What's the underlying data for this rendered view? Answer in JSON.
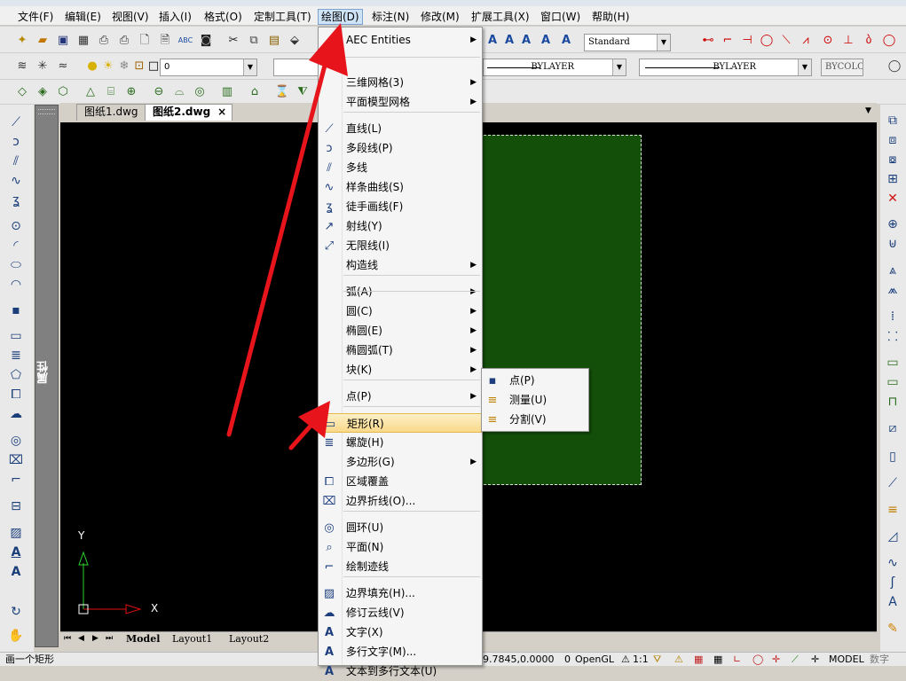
{
  "menubar": {
    "items": [
      "文件(F)",
      "编辑(E)",
      "视图(V)",
      "插入(I)",
      "格式(O)",
      "定制工具(T)",
      "绘图(D)",
      "标注(N)",
      "修改(M)",
      "扩展工具(X)",
      "窗口(W)",
      "帮助(H)"
    ],
    "active_index": 6
  },
  "toolbar1": {
    "text_style": "Standard"
  },
  "toolbar2": {
    "layer_value": "0",
    "linetype1": "BYLAYER",
    "linetype2": "BYLAYER",
    "color": "BYCOLOR"
  },
  "doc_tabs": {
    "tab1": "图纸1.dwg",
    "tab2": "图纸2.dwg",
    "close_glyph": "×"
  },
  "properties_panel": {
    "label": "属性"
  },
  "layout_tabs": [
    "Model",
    "Layout1",
    "Layout2"
  ],
  "ucs": {
    "x": "X",
    "y": "Y"
  },
  "draw_menu": {
    "items": [
      {
        "label": "AEC Entities",
        "icon": "",
        "submenu": true
      },
      {
        "label": "三维网格(3)",
        "icon": "",
        "submenu": true
      },
      {
        "label": "平面模型网格",
        "icon": "",
        "submenu": true
      },
      {
        "label": "直线(L)",
        "icon": "line-icon",
        "submenu": false
      },
      {
        "label": "多段线(P)",
        "icon": "polyline-icon",
        "submenu": false
      },
      {
        "label": "多线",
        "icon": "multiline-icon",
        "submenu": false
      },
      {
        "label": "样条曲线(S)",
        "icon": "spline-icon",
        "submenu": false
      },
      {
        "label": "徒手画线(F)",
        "icon": "sketch-icon",
        "submenu": false
      },
      {
        "label": "射线(Y)",
        "icon": "ray-icon",
        "submenu": false
      },
      {
        "label": "无限线(I)",
        "icon": "xline-icon",
        "submenu": false
      },
      {
        "label": "构造线",
        "icon": "",
        "submenu": true
      },
      {
        "label": "弧(A)",
        "icon": "",
        "submenu": true
      },
      {
        "label": "圆(C)",
        "icon": "",
        "submenu": true
      },
      {
        "label": "椭圆(E)",
        "icon": "",
        "submenu": true
      },
      {
        "label": "椭圆弧(T)",
        "icon": "",
        "submenu": true
      },
      {
        "label": "块(K)",
        "icon": "",
        "submenu": true
      },
      {
        "label": "点(P)",
        "icon": "",
        "submenu": true
      },
      {
        "label": "矩形(R)",
        "icon": "rectangle-icon",
        "submenu": false
      },
      {
        "label": "螺旋(H)",
        "icon": "helix-icon",
        "submenu": false
      },
      {
        "label": "多边形(G)",
        "icon": "",
        "submenu": true
      },
      {
        "label": "区域覆盖",
        "icon": "wipeout-icon",
        "submenu": false
      },
      {
        "label": "边界折线(O)...",
        "icon": "boundary-icon",
        "submenu": false
      },
      {
        "label": "圆环(U)",
        "icon": "donut-icon",
        "submenu": false
      },
      {
        "label": "平面(N)",
        "icon": "planesurf-icon",
        "submenu": false
      },
      {
        "label": "绘制迹线",
        "icon": "trace-icon",
        "submenu": false
      },
      {
        "label": "边界填充(H)...",
        "icon": "hatch-icon",
        "submenu": false
      },
      {
        "label": "修订云线(V)",
        "icon": "revcloud-icon",
        "submenu": false
      },
      {
        "label": "文字(X)",
        "icon": "text-icon",
        "submenu": false
      },
      {
        "label": "多行文字(M)...",
        "icon": "mtext-icon",
        "submenu": false
      },
      {
        "label": "文本到多行文本(U)",
        "icon": "txt2mtxt-icon",
        "submenu": false
      }
    ],
    "highlighted_index": 17
  },
  "point_submenu": {
    "items": [
      "点(P)",
      "测量(U)",
      "分割(V)"
    ]
  },
  "status": {
    "prompt": "画一个矩形",
    "coords": "9.7845,0.0000",
    "count": "0",
    "renderer": "OpenGL",
    "scale": "1:1",
    "mode": "MODEL",
    "numeric": "数字"
  },
  "colors": {
    "canvas": "#000000",
    "rectangle_fill": "#144f0a",
    "arrow": "#e8141c",
    "menu_highlight": "#f9d98a"
  }
}
